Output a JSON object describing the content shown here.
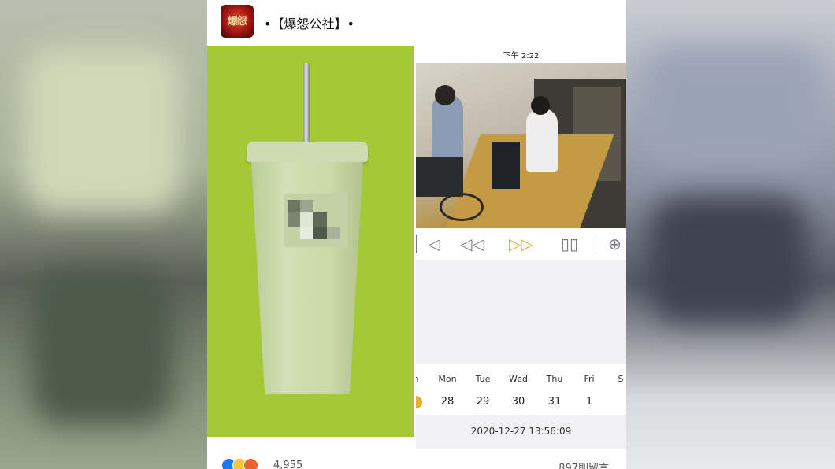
{
  "post": {
    "page_name": "•【爆怨公社】•",
    "avatar_text": "爆怨"
  },
  "cctv_app": {
    "status_time": "下午 2:22",
    "calendar": {
      "days": [
        "n",
        "Mon",
        "Tue",
        "Wed",
        "Thu",
        "Fri",
        "S"
      ],
      "dates": [
        "",
        "28",
        "29",
        "30",
        "31",
        "1",
        ""
      ]
    },
    "datetime": "2020-12-27 13:56:09"
  },
  "footer": {
    "reaction_count": "4,955",
    "comment_count": "897則留言"
  },
  "colors": {
    "cup_background": "#a3c936",
    "accent_orange": "#f0a92a",
    "like_blue": "#1877f2"
  }
}
